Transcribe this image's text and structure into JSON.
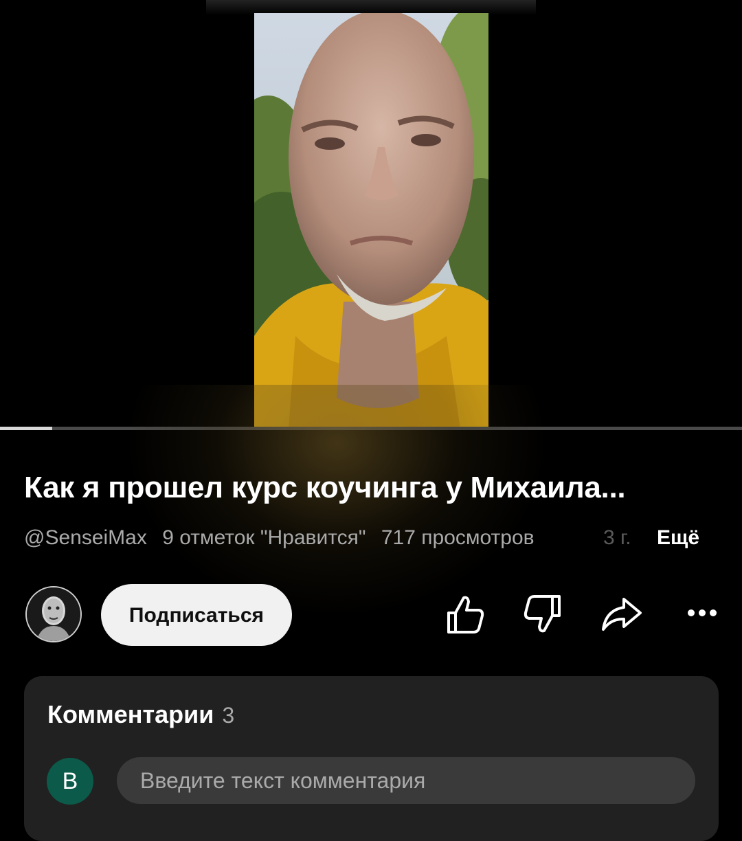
{
  "player": {
    "progress_fraction": 0.07
  },
  "video": {
    "title": "Как я прошел курс коучинга у Михаила...",
    "channel_handle": "@SenseiMax",
    "likes_text": "9 отметок \"Нравится\"",
    "views_text": "717 просмотров",
    "age_text": "3 г.",
    "more_label": "Ещё"
  },
  "actions": {
    "subscribe_label": "Подписаться",
    "icons": [
      "like-icon",
      "dislike-icon",
      "share-icon",
      "more-icon"
    ]
  },
  "comments": {
    "heading": "Комментарии",
    "count": "3",
    "user_initial": "B",
    "user_avatar_color": "#0c5b4a",
    "input_placeholder": "Введите текст комментария"
  }
}
